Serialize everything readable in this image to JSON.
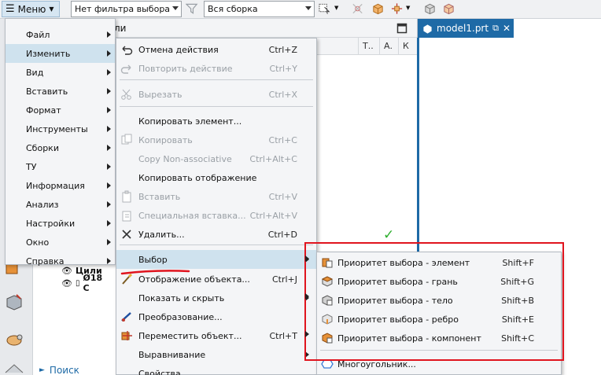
{
  "toolbar": {
    "menu_label": "Меню",
    "filter_value": "Нет фильтра выбора",
    "scope_value": "Вся сборка"
  },
  "navigator": {
    "header_fragment": "ли",
    "columns": [
      "Т..",
      "А.",
      "К"
    ],
    "rows": [
      {
        "label": "Цили"
      },
      {
        "label": "Ø18 С"
      }
    ],
    "search_label": "Поиск"
  },
  "view": {
    "tab_label": "model1.prt"
  },
  "main_menu": {
    "items": [
      {
        "label": "Файл"
      },
      {
        "label": "Изменить"
      },
      {
        "label": "Вид"
      },
      {
        "label": "Вставить"
      },
      {
        "label": "Формат"
      },
      {
        "label": "Инструменты"
      },
      {
        "label": "Сборки"
      },
      {
        "label": "ТУ"
      },
      {
        "label": "Информация"
      },
      {
        "label": "Анализ"
      },
      {
        "label": "Настройки"
      },
      {
        "label": "Окно"
      },
      {
        "label": "Справка"
      }
    ]
  },
  "edit_menu": {
    "items": [
      {
        "label": "Отмена действия",
        "shortcut": "Ctrl+Z",
        "icon": "undo-icon"
      },
      {
        "label": "Повторить действие",
        "shortcut": "Ctrl+Y",
        "icon": "redo-icon"
      },
      {
        "label": "Вырезать",
        "shortcut": "Ctrl+X",
        "icon": "cut-icon"
      },
      {
        "label": "Копировать элемент...",
        "shortcut": ""
      },
      {
        "label": "Копировать",
        "shortcut": "Ctrl+C",
        "icon": "copy-icon"
      },
      {
        "label": "Copy Non-associative",
        "shortcut": "Ctrl+Alt+C"
      },
      {
        "label": "Копировать отображение",
        "shortcut": ""
      },
      {
        "label": "Вставить",
        "shortcut": "Ctrl+V",
        "icon": "paste-icon"
      },
      {
        "label": "Специальная вставка...",
        "shortcut": "Ctrl+Alt+V",
        "icon": "paste-special-icon"
      },
      {
        "label": "Удалить...",
        "shortcut": "Ctrl+D",
        "icon": "delete-icon"
      },
      {
        "label": "Выбор",
        "shortcut": ""
      },
      {
        "label": "Отображение объекта...",
        "shortcut": "Ctrl+J",
        "icon": "brush-icon"
      },
      {
        "label": "Показать и скрыть",
        "shortcut": ""
      },
      {
        "label": "Преобразование...",
        "shortcut": "",
        "icon": "transform-icon"
      },
      {
        "label": "Переместить объект...",
        "shortcut": "Ctrl+T",
        "icon": "move-icon"
      },
      {
        "label": "Выравнивание",
        "shortcut": ""
      },
      {
        "label": "Свойства...",
        "shortcut": ""
      }
    ]
  },
  "selection_menu": {
    "items": [
      {
        "label": "Приоритет выбора - элемент",
        "shortcut": "Shift+F"
      },
      {
        "label": "Приоритет выбора - грань",
        "shortcut": "Shift+G"
      },
      {
        "label": "Приоритет выбора - тело",
        "shortcut": "Shift+B"
      },
      {
        "label": "Приоритет выбора - ребро",
        "shortcut": "Shift+E"
      },
      {
        "label": "Приоритет выбора - компонент",
        "shortcut": "Shift+C"
      },
      {
        "label": "Многоугольник...",
        "shortcut": ""
      }
    ]
  },
  "colors": {
    "accent": "#1e6aa6",
    "highlight": "#cfe2ee",
    "annotation_red": "#e0141e",
    "check_green": "#2eaf2e"
  }
}
